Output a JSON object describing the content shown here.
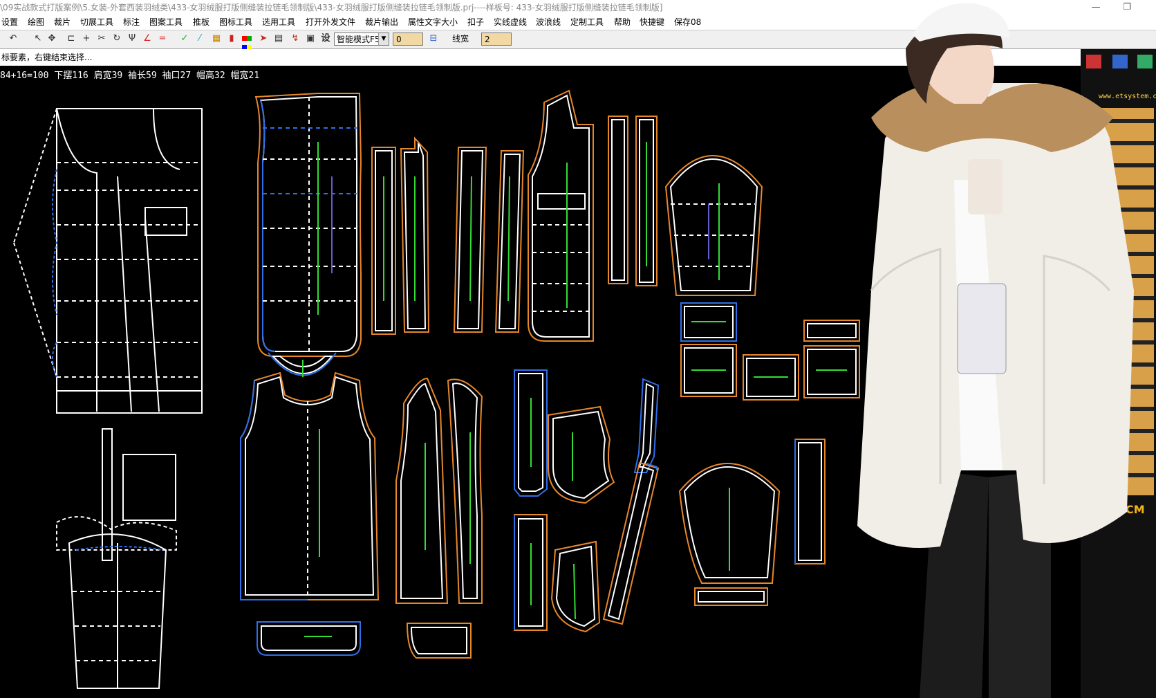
{
  "window": {
    "title": "\\09实战款式打版案例\\5.女装-外套西装羽绒类\\433-女羽绒服打版侧缝装拉链毛领制版\\433-女羽绒服打版侧缝装拉链毛领制版.prj----样板号: 433-女羽绒服打版侧缝装拉链毛领制版]"
  },
  "menu": [
    "设置",
    "绘图",
    "裁片",
    "切展工具",
    "标注",
    "图案工具",
    "推板",
    "图标工具",
    "选用工具",
    "打开外发文件",
    "裁片输出",
    "属性文字大小",
    "扣子",
    "实线虚线",
    "波浪线",
    "定制工具",
    "帮助",
    "快捷键",
    "保存08"
  ],
  "toolbar": {
    "set_label": "设",
    "mode_select": "智能模式F5",
    "value_field": "0",
    "line_width_label": "线宽",
    "line_width_value": "2"
  },
  "status": {
    "hint": "标要素，右键结束选择..."
  },
  "measurements": "84+16=100  下摆116  肩宽39  袖长59  袖口27  帽高32  帽宽21",
  "right_panel": {
    "watermark": "www.etsystem.c",
    "cm_label": "CM"
  },
  "colors": {
    "canvas": "#000000",
    "pattern_line": "#ffffff",
    "seam_line": "#e8872a",
    "highlight_line": "#2f6fe8",
    "grain_line": "#33dd33",
    "menu_bg": "#ffffff",
    "field_bg": "#f2d9a4",
    "coat": "#f1eee8"
  },
  "icons": [
    "undo-icon",
    "select-arrow-icon",
    "move-icon",
    "ruler-icon",
    "cross-icon",
    "rotate-icon",
    "fork-icon",
    "line-icon",
    "equal-icon",
    "angle-icon",
    "color-palette-icon",
    "arrow-tool-icon",
    "dotted-line-icon",
    "measure-icon",
    "text-icon",
    "gear-icon"
  ]
}
